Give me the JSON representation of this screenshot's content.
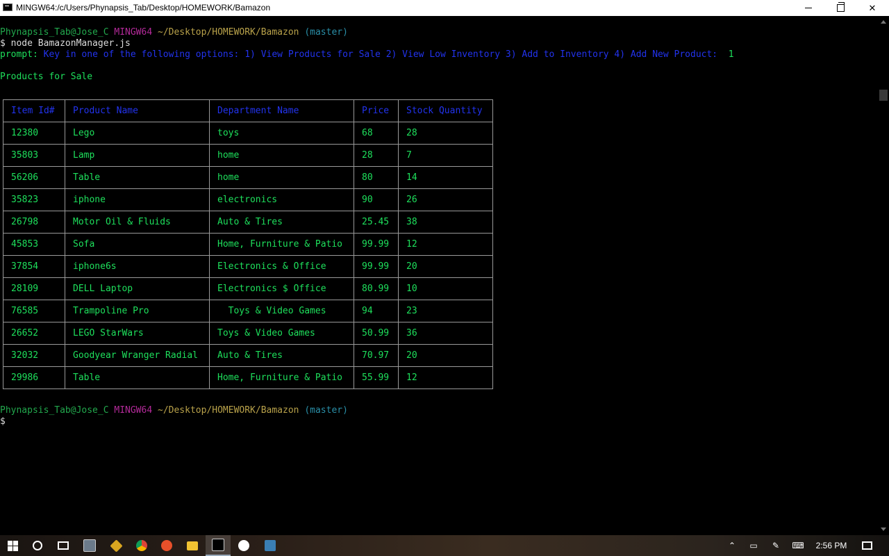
{
  "window": {
    "title": "MINGW64:/c/Users/Phynapsis_Tab/Desktop/HOMEWORK/Bamazon"
  },
  "terminal": {
    "prompt1": {
      "user": "Phynapsis_Tab@Jose_C",
      "shell": "MINGW64",
      "path": "~/Desktop/HOMEWORK/Bamazon",
      "branch": "(master)"
    },
    "command": "$ node BamazonManager.js",
    "prompt_label": "prompt:",
    "prompt_question": "Key in one of the following options: 1) View Products for Sale 2) View Low Inventory 3) Add to Inventory 4) Add New Product:",
    "prompt_answer": "1",
    "section_title": "Products for Sale",
    "table": {
      "headers": [
        "Item Id#",
        "Product Name",
        "Department Name",
        "Price",
        "Stock Quantity"
      ],
      "rows": [
        [
          "12380",
          "Lego",
          "toys",
          "68",
          "28"
        ],
        [
          "35803",
          "Lamp",
          "home",
          "28",
          "7"
        ],
        [
          "56206",
          "Table",
          "home",
          "80",
          "14"
        ],
        [
          "35823",
          "iphone",
          "electronics",
          "90",
          "26"
        ],
        [
          "26798",
          "Motor Oil & Fluids",
          "Auto & Tires",
          "25.45",
          "38"
        ],
        [
          "45853",
          "Sofa",
          "Home, Furniture & Patio",
          "99.99",
          "12"
        ],
        [
          "37854",
          "iphone6s",
          "Electronics & Office",
          "99.99",
          "20"
        ],
        [
          "28109",
          "DELL Laptop",
          "Electronics $ Office",
          "80.99",
          "10"
        ],
        [
          "76585",
          "Trampoline Pro",
          "  Toys & Video Games",
          "94",
          "23"
        ],
        [
          "26652",
          "LEGO StarWars",
          "Toys & Video Games",
          "50.99",
          "36"
        ],
        [
          "32032",
          "Goodyear Wranger Radial",
          "Auto & Tires",
          "70.97",
          "20"
        ],
        [
          "29986",
          "Table",
          "Home, Furniture & Patio",
          "55.99",
          "12"
        ]
      ]
    },
    "prompt2": {
      "user": "Phynapsis_Tab@Jose_C",
      "shell": "MINGW64",
      "path": "~/Desktop/HOMEWORK/Bamazon",
      "branch": "(master)"
    },
    "dollar": "$"
  },
  "taskbar": {
    "clock": "2:56 PM",
    "apps": [
      "start-button",
      "cortana-search",
      "task-view",
      "file-app",
      "git-app",
      "chrome-app",
      "app-orange",
      "file-explorer",
      "terminal-app",
      "unity-app",
      "mysql-app"
    ]
  },
  "colors": {
    "terminal_bg": "#000000",
    "green": "#1ee05c",
    "blue": "#2233ee",
    "magenta": "#b42a9a",
    "yellow": "#b9a24a",
    "cyan": "#2a8fa8"
  }
}
